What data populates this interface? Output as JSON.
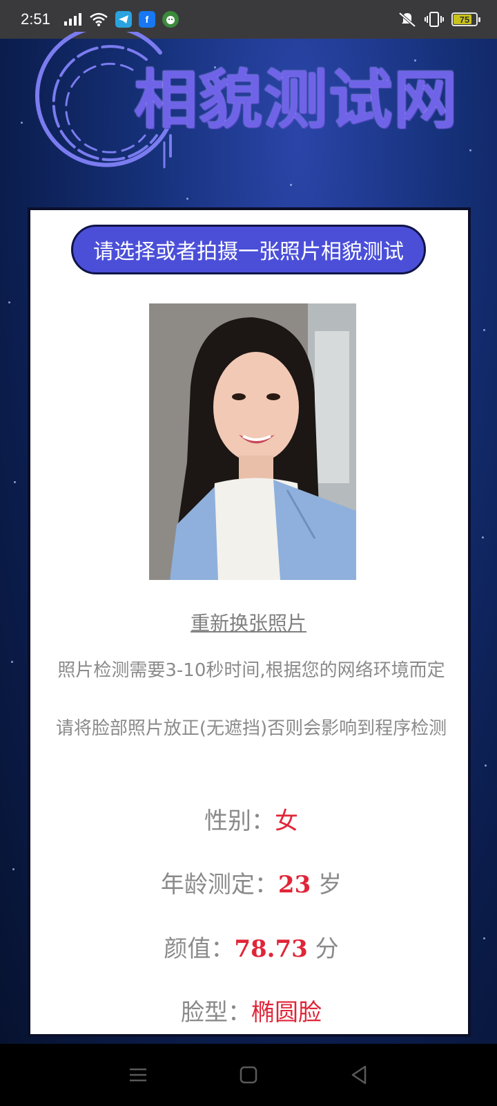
{
  "status_bar": {
    "time": "2:51",
    "battery_level": "75",
    "icons": [
      "signal-icon",
      "wifi-icon",
      "telegram-icon",
      "facebook-icon",
      "android-icon",
      "mute-icon",
      "vibrate-icon",
      "battery-icon"
    ],
    "facebook_letter": "f"
  },
  "header": {
    "site_title": "相貌测试网"
  },
  "card": {
    "title": "请选择或者拍摄一张照片相貌测试",
    "change_photo_link": "重新换张照片",
    "notice_time": "照片检测需要3-10秒时间,根据您的网络环境而定",
    "notice_face": "请将脸部照片放正(无遮挡)否则会影响到程序检测"
  },
  "results": {
    "gender_label": "性别：",
    "gender_value": "女",
    "age_label": "年龄测定：",
    "age_value": "23",
    "age_unit": " 岁",
    "score_label": "颜值：",
    "score_value": "78.73",
    "score_unit": " 分",
    "face_shape_label": "脸型：",
    "face_shape_value": "椭圆脸"
  },
  "colors": {
    "accent_purple": "#4b4fd8",
    "result_red": "#e02538",
    "title_purple": "#6f63e8"
  }
}
